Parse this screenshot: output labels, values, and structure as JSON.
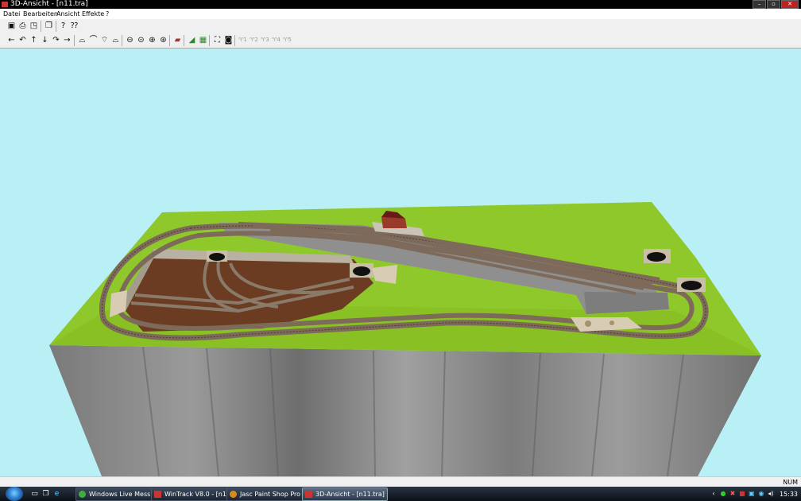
{
  "window": {
    "title": "3D-Ansicht - [n11.tra]"
  },
  "menu": [
    "Datei",
    "Bearbeiten",
    "Ansicht",
    "Effekte",
    "?"
  ],
  "status": {
    "num": "NUM"
  },
  "taskbar": {
    "tasks": [
      {
        "label": "Windows Live Mess...",
        "icon_color": "#3fae3f"
      },
      {
        "label": "WinTrack  V8.0 - [n1...",
        "icon_color": "#c33"
      },
      {
        "label": "Jasc Paint Shop Pro ...",
        "icon_color": "#d98a1a"
      },
      {
        "label": "3D-Ansicht - [n11.tra]",
        "icon_color": "#c33"
      }
    ],
    "clock": "15:33"
  },
  "scene": {
    "sky_color": "#b8f0f6",
    "grass_color": "#8fc82a",
    "ground_color": "#6b3b22",
    "cliff_color": "#8a8a8a",
    "track_color": "#7d6a5a",
    "platform_color": "#8f8f8f"
  }
}
